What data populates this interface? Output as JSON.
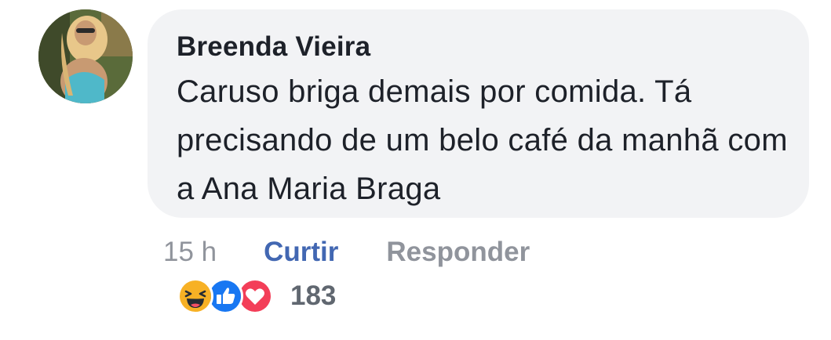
{
  "comment": {
    "author": "Breenda Vieira",
    "text": "Caruso briga demais por comida. Tá precisando de um belo café da manhã com a Ana Maria Braga",
    "time": "15 h",
    "like_label": "Curtir",
    "reply_label": "Responder",
    "reactions": {
      "icons": [
        "haha-icon",
        "like-icon",
        "love-icon"
      ],
      "count": "183"
    }
  },
  "colors": {
    "bubble": "#f2f3f5",
    "text": "#1d2129",
    "link_blue": "#4267b2",
    "muted": "#90949c",
    "haha": "#f7b125",
    "like": "#1877f2",
    "love": "#f33e58"
  }
}
